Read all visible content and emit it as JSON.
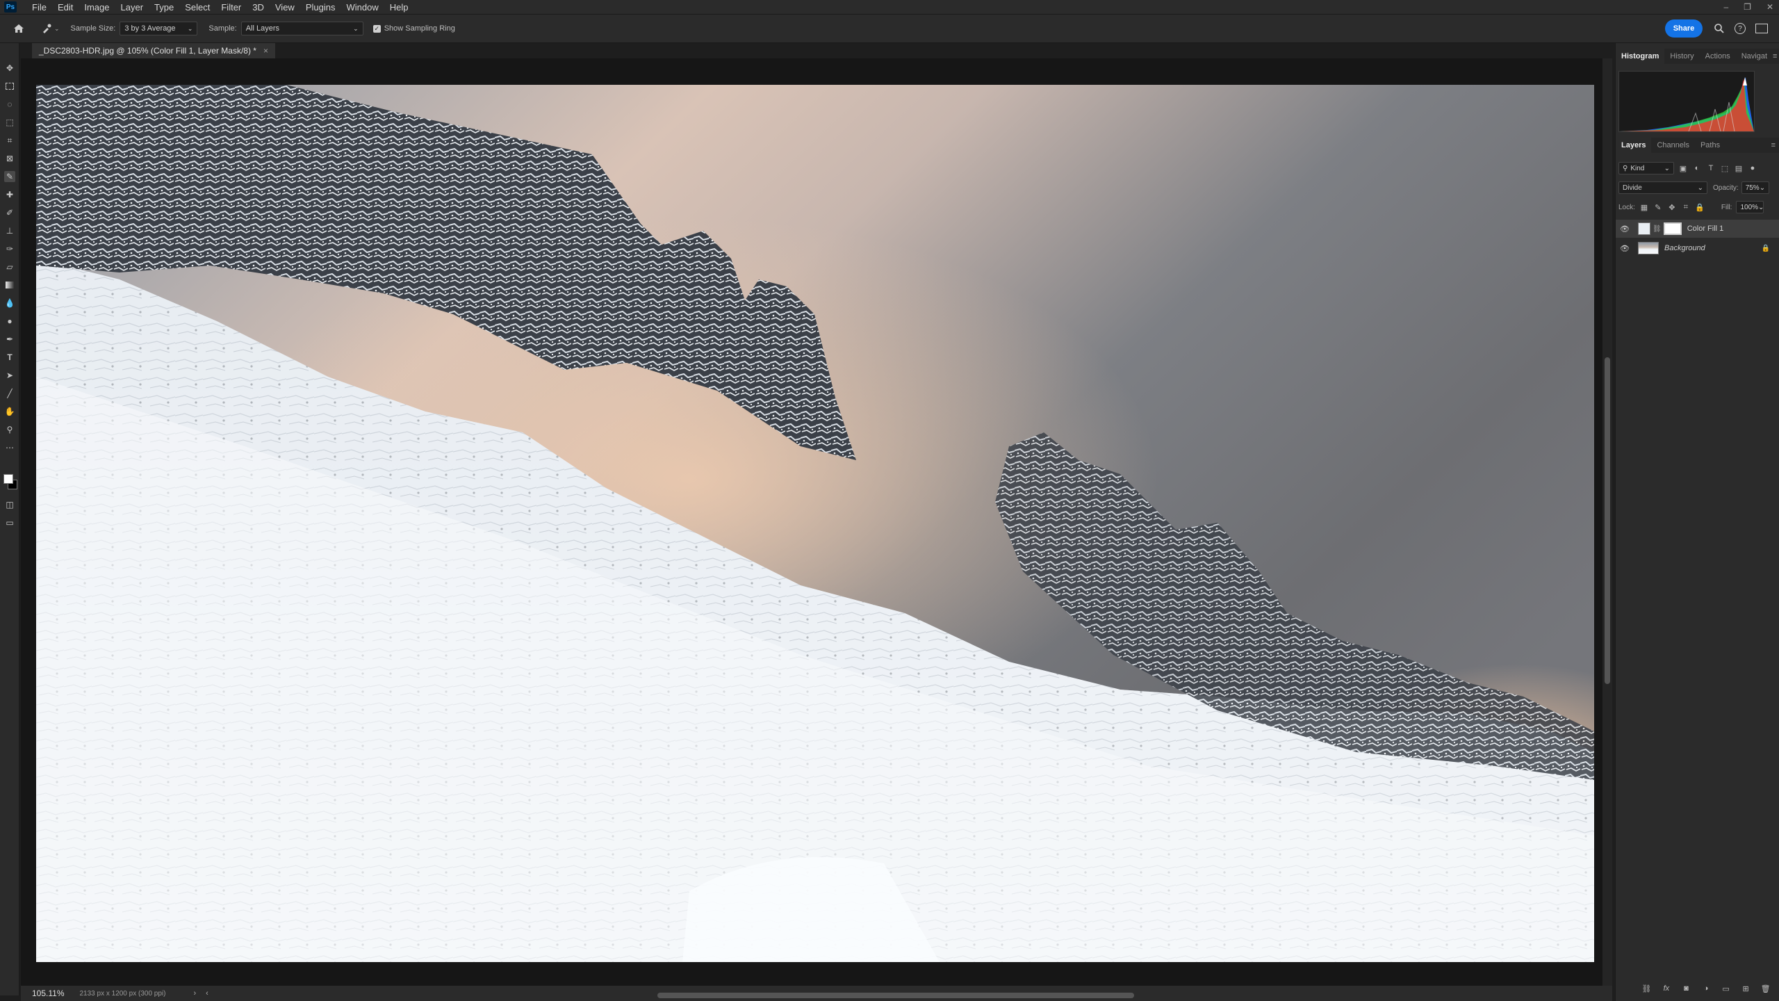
{
  "app": {
    "logo": "Ps"
  },
  "menu": [
    "File",
    "Edit",
    "Image",
    "Layer",
    "Type",
    "Select",
    "Filter",
    "3D",
    "View",
    "Plugins",
    "Window",
    "Help"
  ],
  "window_controls": {
    "minimize": "–",
    "restore": "❐",
    "close": "✕"
  },
  "options": {
    "sample_size_label": "Sample Size:",
    "sample_size_value": "3 by 3 Average",
    "sample_label": "Sample:",
    "sample_value": "All Layers",
    "show_ring_label": "Show Sampling Ring",
    "show_ring_checked": true,
    "share_label": "Share"
  },
  "document": {
    "tab_title": "_DSC2803-HDR.jpg @ 105% (Color Fill 1, Layer Mask/8) *",
    "close_glyph": "×"
  },
  "status": {
    "zoom": "105.11%",
    "dimensions": "2133 px x 1200 px (300 ppi)"
  },
  "panels": {
    "top_tabs": [
      "Histogram",
      "History",
      "Actions",
      "Navigat"
    ],
    "layer_tabs": [
      "Layers",
      "Channels",
      "Paths"
    ],
    "filter_kind": "Kind",
    "blend_mode": "Divide",
    "opacity_label": "Opacity:",
    "opacity_value": "75%",
    "lock_label": "Lock:",
    "fill_label": "Fill:",
    "fill_value": "100%",
    "layers": [
      {
        "name": "Color Fill 1",
        "visible": true,
        "selected": true
      },
      {
        "name": "Background",
        "visible": true,
        "selected": false,
        "locked": true
      }
    ]
  },
  "colors": {
    "accent": "#1473e6",
    "panel_bg": "#2b2b2b",
    "canvas_bg": "#161616"
  }
}
